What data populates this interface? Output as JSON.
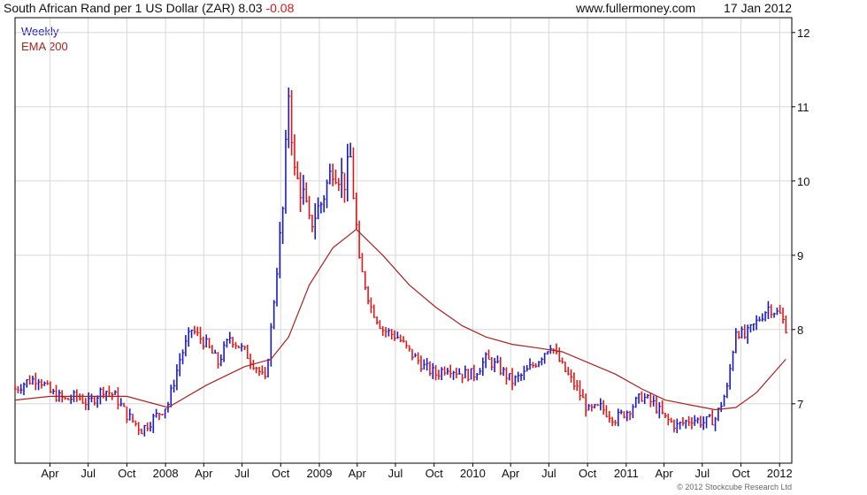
{
  "header": {
    "title": "South African Rand per 1 US Dollar (ZAR) 8.03",
    "change": "-0.08",
    "site": "www.fullermoney.com",
    "date": "17 Jan 2012"
  },
  "legend": {
    "weekly": "Weekly",
    "ema": "EMA 200"
  },
  "copyright": "© 2012 Stockcube Research Ltd",
  "colors": {
    "up": "#1a1acc",
    "down": "#e01818",
    "ema": "#aa2222",
    "grid": "#d8d8d8",
    "axis": "#000000"
  },
  "chart_data": {
    "type": "line",
    "style": "weekly bars (up=blue, down=red) with EMA overlay",
    "title": "South African Rand per 1 US Dollar (ZAR)",
    "last_value": 8.03,
    "last_change": -0.08,
    "ylim": [
      6.2,
      12.2
    ],
    "y_ticks": [
      7,
      8,
      9,
      10,
      11,
      12
    ],
    "x_tick_labels": [
      "Apr",
      "Jul",
      "Oct",
      "2008",
      "Apr",
      "Jul",
      "Oct",
      "2009",
      "Apr",
      "Jul",
      "Oct",
      "2010",
      "Apr",
      "Jul",
      "Oct",
      "2011",
      "Apr",
      "Jul",
      "Oct",
      "2012"
    ],
    "x_tick_dates": [
      "2007-04-01",
      "2007-07-01",
      "2007-10-01",
      "2008-01-01",
      "2008-04-01",
      "2008-07-01",
      "2008-10-01",
      "2009-01-01",
      "2009-04-01",
      "2009-07-01",
      "2009-10-01",
      "2010-01-01",
      "2010-04-01",
      "2010-07-01",
      "2010-10-01",
      "2011-01-01",
      "2011-04-01",
      "2011-07-01",
      "2011-10-01",
      "2012-01-01"
    ],
    "xlim": [
      "2007-01-08",
      "2012-01-30"
    ],
    "grid": true,
    "legend_position": "top-left",
    "series": [
      {
        "name": "Weekly",
        "kind": "close",
        "x": [
          "2007-01-08",
          "2007-02-05",
          "2007-03-05",
          "2007-04-02",
          "2007-05-07",
          "2007-06-04",
          "2007-07-02",
          "2007-08-06",
          "2007-09-03",
          "2007-10-01",
          "2007-11-05",
          "2007-12-03",
          "2008-01-07",
          "2008-02-04",
          "2008-03-03",
          "2008-04-07",
          "2008-05-05",
          "2008-06-02",
          "2008-07-07",
          "2008-08-04",
          "2008-08-25",
          "2008-09-08",
          "2008-10-06",
          "2008-10-20",
          "2008-11-03",
          "2008-11-24",
          "2008-12-08",
          "2009-01-05",
          "2009-02-02",
          "2009-03-02",
          "2009-03-16",
          "2009-04-06",
          "2009-05-04",
          "2009-06-01",
          "2009-07-06",
          "2009-08-03",
          "2009-09-07",
          "2009-10-05",
          "2009-11-02",
          "2009-12-07",
          "2010-01-04",
          "2010-02-01",
          "2010-03-01",
          "2010-04-05",
          "2010-05-03",
          "2010-06-07",
          "2010-07-05",
          "2010-08-02",
          "2010-09-06",
          "2010-10-04",
          "2010-11-01",
          "2010-12-06",
          "2011-01-03",
          "2011-02-07",
          "2011-03-07",
          "2011-04-04",
          "2011-05-02",
          "2011-06-06",
          "2011-07-04",
          "2011-08-01",
          "2011-08-29",
          "2011-09-19",
          "2011-10-10",
          "2011-11-07",
          "2011-12-05",
          "2012-01-02",
          "2012-01-16"
        ],
        "values": [
          7.2,
          7.3,
          7.35,
          7.15,
          7.05,
          7.1,
          7.0,
          7.2,
          7.1,
          6.85,
          6.65,
          6.8,
          7.0,
          7.6,
          8.0,
          7.8,
          7.55,
          7.9,
          7.7,
          7.5,
          7.3,
          8.0,
          9.6,
          11.2,
          10.1,
          9.8,
          9.4,
          9.7,
          10.2,
          10.0,
          10.3,
          8.9,
          8.3,
          8.0,
          7.9,
          7.7,
          7.5,
          7.4,
          7.5,
          7.4,
          7.4,
          7.6,
          7.5,
          7.3,
          7.4,
          7.6,
          7.8,
          7.5,
          7.2,
          6.9,
          6.95,
          6.8,
          6.9,
          7.1,
          7.0,
          6.8,
          6.7,
          6.8,
          6.75,
          6.8,
          7.2,
          8.0,
          7.9,
          8.1,
          8.3,
          8.2,
          8.03
        ]
      },
      {
        "name": "EMA 200",
        "kind": "ema",
        "x": [
          "2007-01-08",
          "2007-04-02",
          "2007-07-02",
          "2007-10-01",
          "2008-01-07",
          "2008-04-07",
          "2008-07-07",
          "2008-09-08",
          "2008-10-20",
          "2008-12-08",
          "2009-02-02",
          "2009-03-30",
          "2009-06-01",
          "2009-08-03",
          "2009-10-05",
          "2009-12-07",
          "2010-02-01",
          "2010-04-05",
          "2010-06-07",
          "2010-08-02",
          "2010-10-04",
          "2010-12-06",
          "2011-02-07",
          "2011-04-04",
          "2011-06-06",
          "2011-08-01",
          "2011-09-19",
          "2011-11-07",
          "2012-01-16"
        ],
        "values": [
          7.05,
          7.1,
          7.1,
          7.1,
          6.95,
          7.25,
          7.5,
          7.6,
          7.9,
          8.6,
          9.1,
          9.35,
          9.0,
          8.6,
          8.3,
          8.05,
          7.9,
          7.8,
          7.75,
          7.7,
          7.55,
          7.4,
          7.2,
          7.05,
          6.98,
          6.92,
          6.95,
          7.15,
          7.6
        ]
      }
    ]
  }
}
